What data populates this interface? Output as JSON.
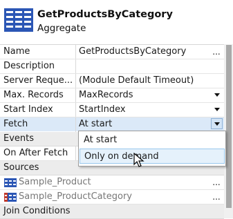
{
  "header": {
    "title": "GetProductsByCategory",
    "subtitle": "Aggregate",
    "icon": "aggregate-table-icon",
    "icon_color": "#2b56b5"
  },
  "properties": [
    {
      "label": "Name",
      "value": "GetProductsByCategory",
      "control": "ellipsis"
    },
    {
      "label": "Description",
      "value": "",
      "control": "none"
    },
    {
      "label": "Server Reque...",
      "value": "(Module Default Timeout)",
      "control": "none"
    },
    {
      "label": "Max. Records",
      "value": "MaxRecords",
      "control": "dropdown"
    },
    {
      "label": "Start Index",
      "value": "StartIndex",
      "control": "dropdown"
    },
    {
      "label": "Fetch",
      "value": "At start",
      "control": "dropdown-open"
    }
  ],
  "ellipsis_label": "...",
  "events": {
    "section_label": "Events",
    "on_after_fetch_label": "On After Fetch"
  },
  "sources": {
    "section_label": "Sources",
    "items": [
      {
        "label": "Sample_Product",
        "icon": "entity-table-icon",
        "icon_color": "#2b56b5"
      },
      {
        "label": "Sample_ProductCategory",
        "icon": "entity-table-icon",
        "icon_color": "#c0392b"
      }
    ]
  },
  "join_conditions_label": "Join Conditions",
  "fetch_dropdown": {
    "options": [
      "At start",
      "Only on demand"
    ],
    "hovered_option": "Only on demand"
  }
}
